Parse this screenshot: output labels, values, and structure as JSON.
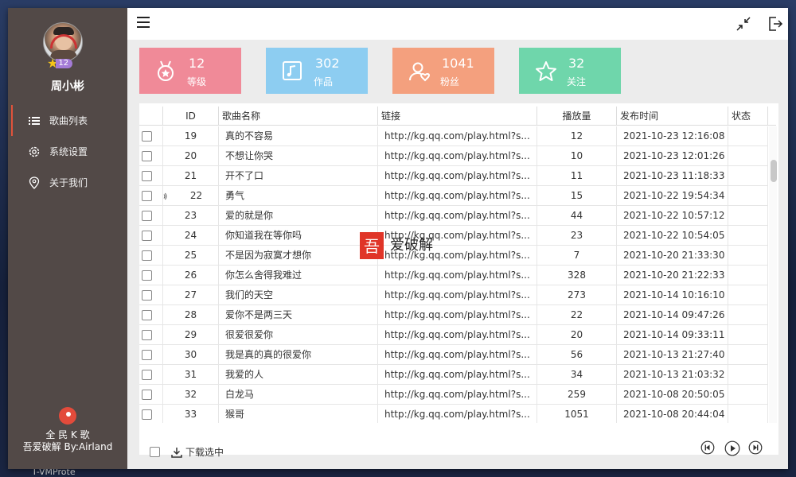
{
  "desktop": {
    "taskbar_text": "T-VMProte"
  },
  "user": {
    "name": "周小彬",
    "level": "12"
  },
  "nav": [
    {
      "label": "歌曲列表",
      "icon": "list-icon",
      "active": true
    },
    {
      "label": "系统设置",
      "icon": "gear-icon",
      "active": false
    },
    {
      "label": "关于我们",
      "icon": "location-pin-icon",
      "active": false
    }
  ],
  "footer": {
    "app_name": "全 民 K 歌",
    "credit": "吾爱破解 By:Airland"
  },
  "stats": [
    {
      "value": "12",
      "label": "等级",
      "color": "#f08a98",
      "icon": "medal-icon"
    },
    {
      "value": "302",
      "label": "作品",
      "color": "#8dcdf1",
      "icon": "music-note-icon"
    },
    {
      "value": "1041",
      "label": "粉丝",
      "color": "#f4a07e",
      "icon": "user-heart-icon"
    },
    {
      "value": "32",
      "label": "关注",
      "color": "#6fd6ab",
      "icon": "star-icon"
    }
  ],
  "table": {
    "headers": {
      "id": "ID",
      "name": "歌曲名称",
      "link": "链接",
      "plays": "播放量",
      "date": "发布时间",
      "status": "状态"
    },
    "rows": [
      {
        "id": "19",
        "name": "真的不容易",
        "link": "http://kg.qq.com/play.html?s...",
        "plays": "12",
        "date": "2021-10-23 12:16:08",
        "playing": false
      },
      {
        "id": "20",
        "name": "不想让你哭",
        "link": "http://kg.qq.com/play.html?s...",
        "plays": "10",
        "date": "2021-10-23 12:01:26",
        "playing": false
      },
      {
        "id": "21",
        "name": "开不了口",
        "link": "http://kg.qq.com/play.html?s...",
        "plays": "11",
        "date": "2021-10-23 11:18:33",
        "playing": false
      },
      {
        "id": "22",
        "name": "勇气",
        "link": "http://kg.qq.com/play.html?s...",
        "plays": "15",
        "date": "2021-10-22 19:54:34",
        "playing": true
      },
      {
        "id": "23",
        "name": "爱的就是你",
        "link": "http://kg.qq.com/play.html?s...",
        "plays": "44",
        "date": "2021-10-22 10:57:12",
        "playing": false
      },
      {
        "id": "24",
        "name": "你知道我在等你吗",
        "link": "http://kg.qq.com/play.html?s...",
        "plays": "23",
        "date": "2021-10-22 10:54:05",
        "playing": false
      },
      {
        "id": "25",
        "name": "不是因为寂寞才想你",
        "link": "http://kg.qq.com/play.html?s...",
        "plays": "7",
        "date": "2021-10-20 21:33:30",
        "playing": false
      },
      {
        "id": "26",
        "name": "你怎么舍得我难过",
        "link": "http://kg.qq.com/play.html?s...",
        "plays": "328",
        "date": "2021-10-20 21:22:33",
        "playing": false
      },
      {
        "id": "27",
        "name": "我们的天空",
        "link": "http://kg.qq.com/play.html?s...",
        "plays": "273",
        "date": "2021-10-14 10:16:10",
        "playing": false
      },
      {
        "id": "28",
        "name": "爱你不是两三天",
        "link": "http://kg.qq.com/play.html?s...",
        "plays": "22",
        "date": "2021-10-14 09:47:26",
        "playing": false
      },
      {
        "id": "29",
        "name": "很爱很爱你",
        "link": "http://kg.qq.com/play.html?s...",
        "plays": "20",
        "date": "2021-10-14 09:33:11",
        "playing": false
      },
      {
        "id": "30",
        "name": "我是真的真的很爱你",
        "link": "http://kg.qq.com/play.html?s...",
        "plays": "56",
        "date": "2021-10-13 21:27:40",
        "playing": false
      },
      {
        "id": "31",
        "name": "我爱的人",
        "link": "http://kg.qq.com/play.html?s...",
        "plays": "34",
        "date": "2021-10-13 21:03:32",
        "playing": false
      },
      {
        "id": "32",
        "name": "白龙马",
        "link": "http://kg.qq.com/play.html?s...",
        "plays": "259",
        "date": "2021-10-08 20:50:05",
        "playing": false
      },
      {
        "id": "33",
        "name": "猴哥",
        "link": "http://kg.qq.com/play.html?s...",
        "plays": "1051",
        "date": "2021-10-08 20:44:04",
        "playing": false
      }
    ]
  },
  "actions": {
    "download_label": "下载选中"
  },
  "watermark": {
    "text": "吾爱破解"
  }
}
